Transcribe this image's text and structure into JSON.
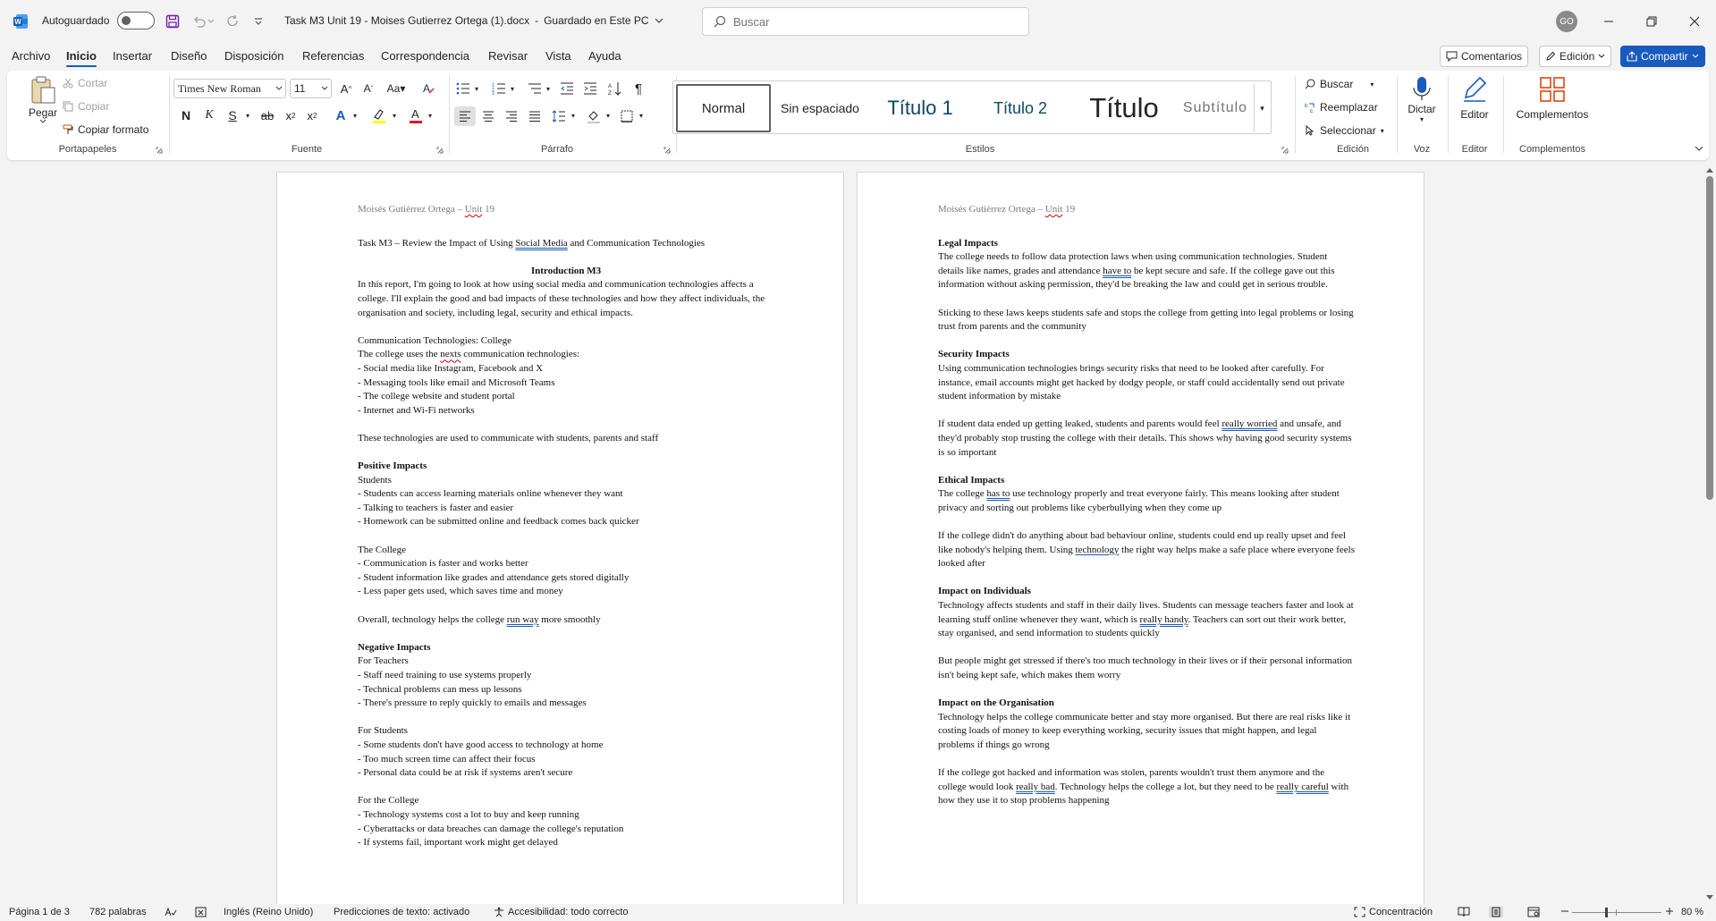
{
  "titlebar": {
    "autosave_label": "Autoguardado",
    "doc_title": "Task M3 Unit 19 - Moises Gutierrez Ortega (1).docx",
    "doc_status": "Guardado en Este PC",
    "search_placeholder": "Buscar",
    "avatar_initials": "GO"
  },
  "menu": {
    "items": [
      "Archivo",
      "Inicio",
      "Insertar",
      "Diseño",
      "Disposición",
      "Referencias",
      "Correspondencia",
      "Revisar",
      "Vista",
      "Ayuda"
    ],
    "comments_label": "Comentarios",
    "editing_label": "Edición",
    "share_label": "Compartir"
  },
  "ribbon": {
    "clipboard": {
      "paste": "Pegar",
      "cut": "Cortar",
      "copy": "Copiar",
      "format_painter": "Copiar formato",
      "group": "Portapapeles"
    },
    "font": {
      "name": "Times New Roman",
      "size": "11",
      "case_label": "Aa",
      "group": "Fuente"
    },
    "paragraph": {
      "group": "Párrafo"
    },
    "styles": {
      "items": [
        "Normal",
        "Sin espaciado",
        "Título 1",
        "Título 2",
        "Título",
        "Subtítulo"
      ],
      "group": "Estilos"
    },
    "editing": {
      "find": "Buscar",
      "replace": "Reemplazar",
      "select": "Seleccionar",
      "group": "Edición"
    },
    "voice": {
      "dictate": "Dictar",
      "group": "Voz"
    },
    "editor": {
      "label": "Editor",
      "group": "Editor"
    },
    "addins": {
      "label": "Complementos",
      "group": "Complementos"
    }
  },
  "page1": {
    "header_pre": "Moisés Gutiérrez Ortega – ",
    "header_unit": "Unit",
    "header_post": " 19",
    "task_pre": "Task M3 – Review the Impact of Using ",
    "task_link": "Social Media",
    "task_post": " and Communication Technologies",
    "intro_heading": "Introduction M3",
    "intro_text": "In this report, I'm going to look at how using social media and communication technologies affects a college. I'll explain the good and bad impacts of these technologies and how they affect individuals, the organisation and society, including legal, security and ethical impacts.",
    "comm_heading": "Communication Technologies: College",
    "comm_pre": "The college uses the ",
    "comm_error": "nexts",
    "comm_post": " communication technologies:",
    "comm_items": [
      "- Social media like Instagram, Facebook and X",
      "- Messaging tools like email and Microsoft Teams",
      "- The college website and student portal",
      "- Internet and Wi-Fi networks"
    ],
    "comm_summary": "These technologies are used to communicate with students, parents and staff",
    "pos_heading": "Positive Impacts",
    "pos_students_label": "Students",
    "pos_students_items": [
      "- Students can access learning materials online whenever they want",
      "- Talking to teachers is faster and easier",
      "- Homework can be submitted online and feedback comes back quicker"
    ],
    "pos_college_label": "The College",
    "pos_college_items": [
      "- Communication is faster and works better",
      "- Student information like grades and attendance gets stored digitally",
      "- Less paper gets used, which saves time and money"
    ],
    "overall_pre": "Overall, technology helps the college ",
    "overall_flag": "run way",
    "overall_post": " more smoothly",
    "neg_heading": "Negative Impacts",
    "neg_teachers_label": "For Teachers",
    "neg_teachers_items": [
      "- Staff need training to use systems properly",
      "- Technical problems can mess up lessons",
      "- There's pressure to reply quickly to emails and messages"
    ],
    "neg_students_label": "For Students",
    "neg_students_items": [
      "- Some students don't have good access to technology at home",
      "- Too much screen time can affect their focus",
      "- Personal data could be at risk if systems aren't secure"
    ],
    "neg_college_label": "For the College",
    "neg_college_items": [
      "- Technology systems cost a lot to buy and keep running",
      "- Cyberattacks or data breaches can damage the college's reputation",
      "- If systems fail, important work might get delayed"
    ]
  },
  "page2": {
    "header_pre": "Moisés Gutiérrez Ortega – ",
    "header_unit": "Unit",
    "header_post": " 19",
    "legal_heading": "Legal Impacts",
    "legal_p1_pre": "The college needs to follow data protection laws when using communication technologies. Student details like names, grades and attendance ",
    "legal_p1_flag": "have to",
    "legal_p1_post": " be kept secure and safe. If the college gave out this information without asking permission, they'd be breaking the law and could get in serious trouble.",
    "legal_p2": "Sticking to these laws keeps students safe and stops the college from getting into legal problems or losing trust from parents and the community",
    "security_heading": "Security Impacts",
    "security_p1": "Using communication technologies brings security risks that need to be looked after carefully. For instance, email accounts might get hacked by dodgy people, or staff could accidentally send out private student information by mistake",
    "security_p2_pre": "If student data ended up getting leaked, students and parents would feel ",
    "security_p2_flag": "really worried",
    "security_p2_post": " and unsafe, and they'd probably stop trusting the college with their details. This shows why having good security systems is so important",
    "ethical_heading": "Ethical Impacts",
    "ethical_p1_pre": "The college ",
    "ethical_p1_flag": "has to",
    "ethical_p1_post": " use technology properly and treat everyone fairly. This means looking after student privacy and sorting out problems like cyberbullying when they come up",
    "ethical_p2_pre": "If the college didn't do anything about bad behaviour online, students could end up really upset and feel like nobody's helping them. Using ",
    "ethical_p2_flag": "technology",
    "ethical_p2_post": " the right way helps make a safe place where everyone feels looked after",
    "individuals_heading": "Impact on Individuals",
    "individuals_p1_pre": "Technology affects students and staff in their daily lives. Students can message teachers faster and look at learning stuff online whenever they want, which is ",
    "individuals_p1_flag": "really handy",
    "individuals_p1_post": ". Teachers can sort out their work better, stay organised, and send information to students quickly",
    "individuals_p2": "But people might get stressed if there's too much technology in their lives or if their personal information isn't being kept safe, which makes them worry",
    "org_heading": "Impact on the Organisation",
    "org_p1": "Technology helps the college communicate better and stay more organised. But there are real risks like it costing loads of money to keep everything working, security issues that might happen, and legal problems if things go wrong",
    "org_p2_pre": "If the college got hacked and information was stolen, parents wouldn't trust them anymore and the college would look ",
    "org_p2_flag1": "really bad",
    "org_p2_mid": ". Technology helps the college a lot, but they need to be ",
    "org_p2_flag2": "really careful",
    "org_p2_post": " with how they use it to stop problems happening"
  },
  "status": {
    "page": "Página 1 de 3",
    "words": "782 palabras",
    "language": "Inglés (Reino Unido)",
    "predictions": "Predicciones de texto: activado",
    "accessibility": "Accesibilidad: todo correcto",
    "focus": "Concentración",
    "zoom": "80 %"
  },
  "colors": {
    "accent": "#185abd",
    "word_blue": "#185abd",
    "error": "#c00000"
  }
}
